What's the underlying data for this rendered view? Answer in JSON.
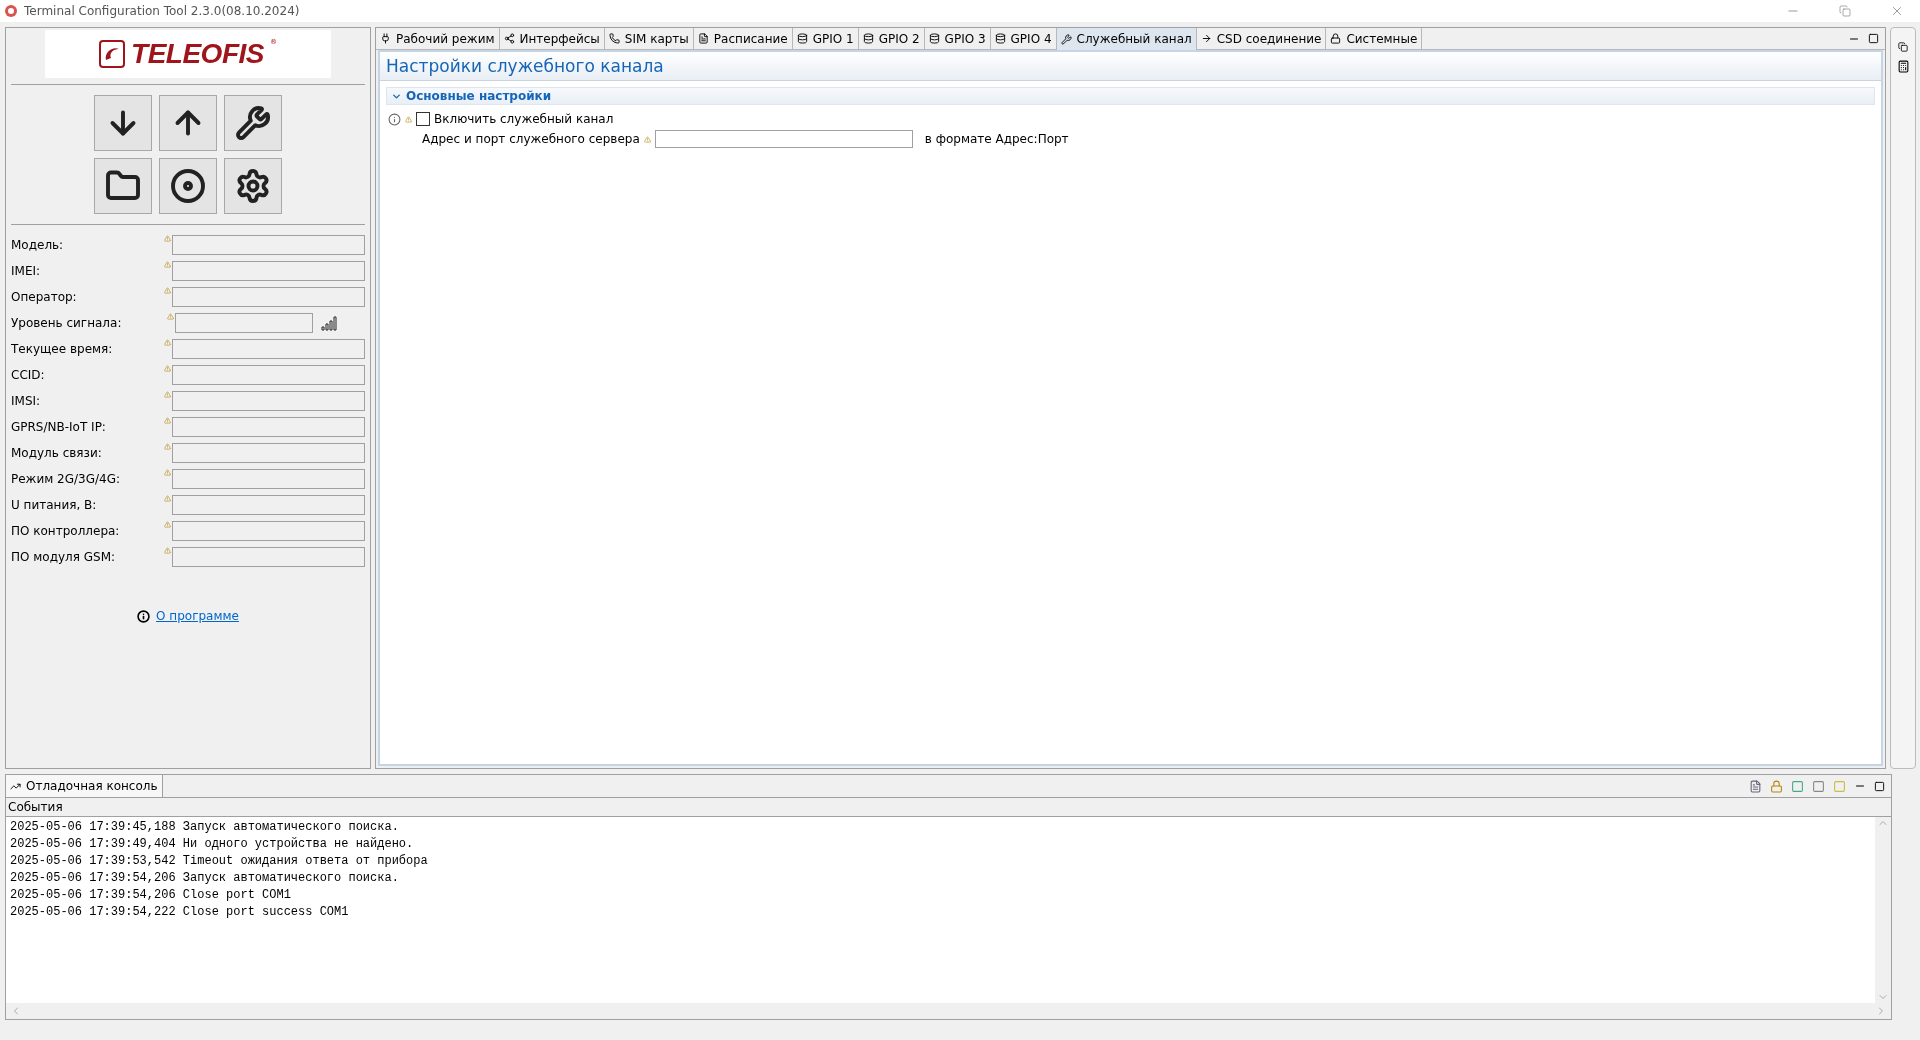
{
  "window": {
    "title": "Terminal Configuration Tool 2.3.0(08.10.2024)"
  },
  "logo": {
    "text": "TELEOFIS",
    "mark": "®"
  },
  "device_info": [
    {
      "label": "Модель:",
      "kind": "text"
    },
    {
      "label": "IMEI:",
      "kind": "text"
    },
    {
      "label": "Оператор:",
      "kind": "text"
    },
    {
      "label": "Уровень сигнала:",
      "kind": "signal"
    },
    {
      "label": "Текущее время:",
      "kind": "text"
    },
    {
      "label": "CCID:",
      "kind": "text"
    },
    {
      "label": "IMSI:",
      "kind": "text"
    },
    {
      "label": "GPRS/NB-IoT IP:",
      "kind": "text"
    },
    {
      "label": "Модуль связи:",
      "kind": "text"
    },
    {
      "label": "Режим 2G/3G/4G:",
      "kind": "text"
    },
    {
      "label": "U питания, В:",
      "kind": "text"
    },
    {
      "label": "ПО контроллера:",
      "kind": "text"
    },
    {
      "label": "ПО модуля GSM:",
      "kind": "text"
    }
  ],
  "about_link": "О программе",
  "tabs": [
    {
      "label": "Рабочий режим",
      "kind": "plug",
      "selected": false
    },
    {
      "label": "Интерфейсы",
      "kind": "nodes",
      "selected": false
    },
    {
      "label": "SIM карты",
      "kind": "phone",
      "selected": false
    },
    {
      "label": "Расписание",
      "kind": "doc",
      "selected": false
    },
    {
      "label": "GPIO 1",
      "kind": "db",
      "selected": false
    },
    {
      "label": "GPIO 2",
      "kind": "db",
      "selected": false
    },
    {
      "label": "GPIO 3",
      "kind": "db",
      "selected": false
    },
    {
      "label": "GPIO 4",
      "kind": "db",
      "selected": false
    },
    {
      "label": "Служебный канал",
      "kind": "wrench",
      "selected": true
    },
    {
      "label": "CSD соединение",
      "kind": "arrow",
      "selected": false
    },
    {
      "label": "Системные",
      "kind": "lock",
      "selected": false
    }
  ],
  "page_title": "Настройки служебного канала",
  "section": {
    "title": "Основные настройки",
    "expanded": true
  },
  "enable_channel": {
    "label": "Включить служебный канал",
    "checked": false
  },
  "server_address": {
    "label": "Адрес и порт служебного сервера",
    "hint": "в формате Адрес:Порт"
  },
  "console": {
    "tab": "Отладочная консоль",
    "header": "События",
    "lines": [
      "2025-05-06 17:39:45,188 Запуск автоматического поиска.",
      "2025-05-06 17:39:49,404 Ни одного устройства не найдено.",
      "2025-05-06 17:39:53,542 Timeout ожидания ответа от прибора",
      "2025-05-06 17:39:54,206 Запуск автоматического поиска.",
      "2025-05-06 17:39:54,206 Close port COM1",
      "2025-05-06 17:39:54,222 Close port success COM1"
    ]
  }
}
